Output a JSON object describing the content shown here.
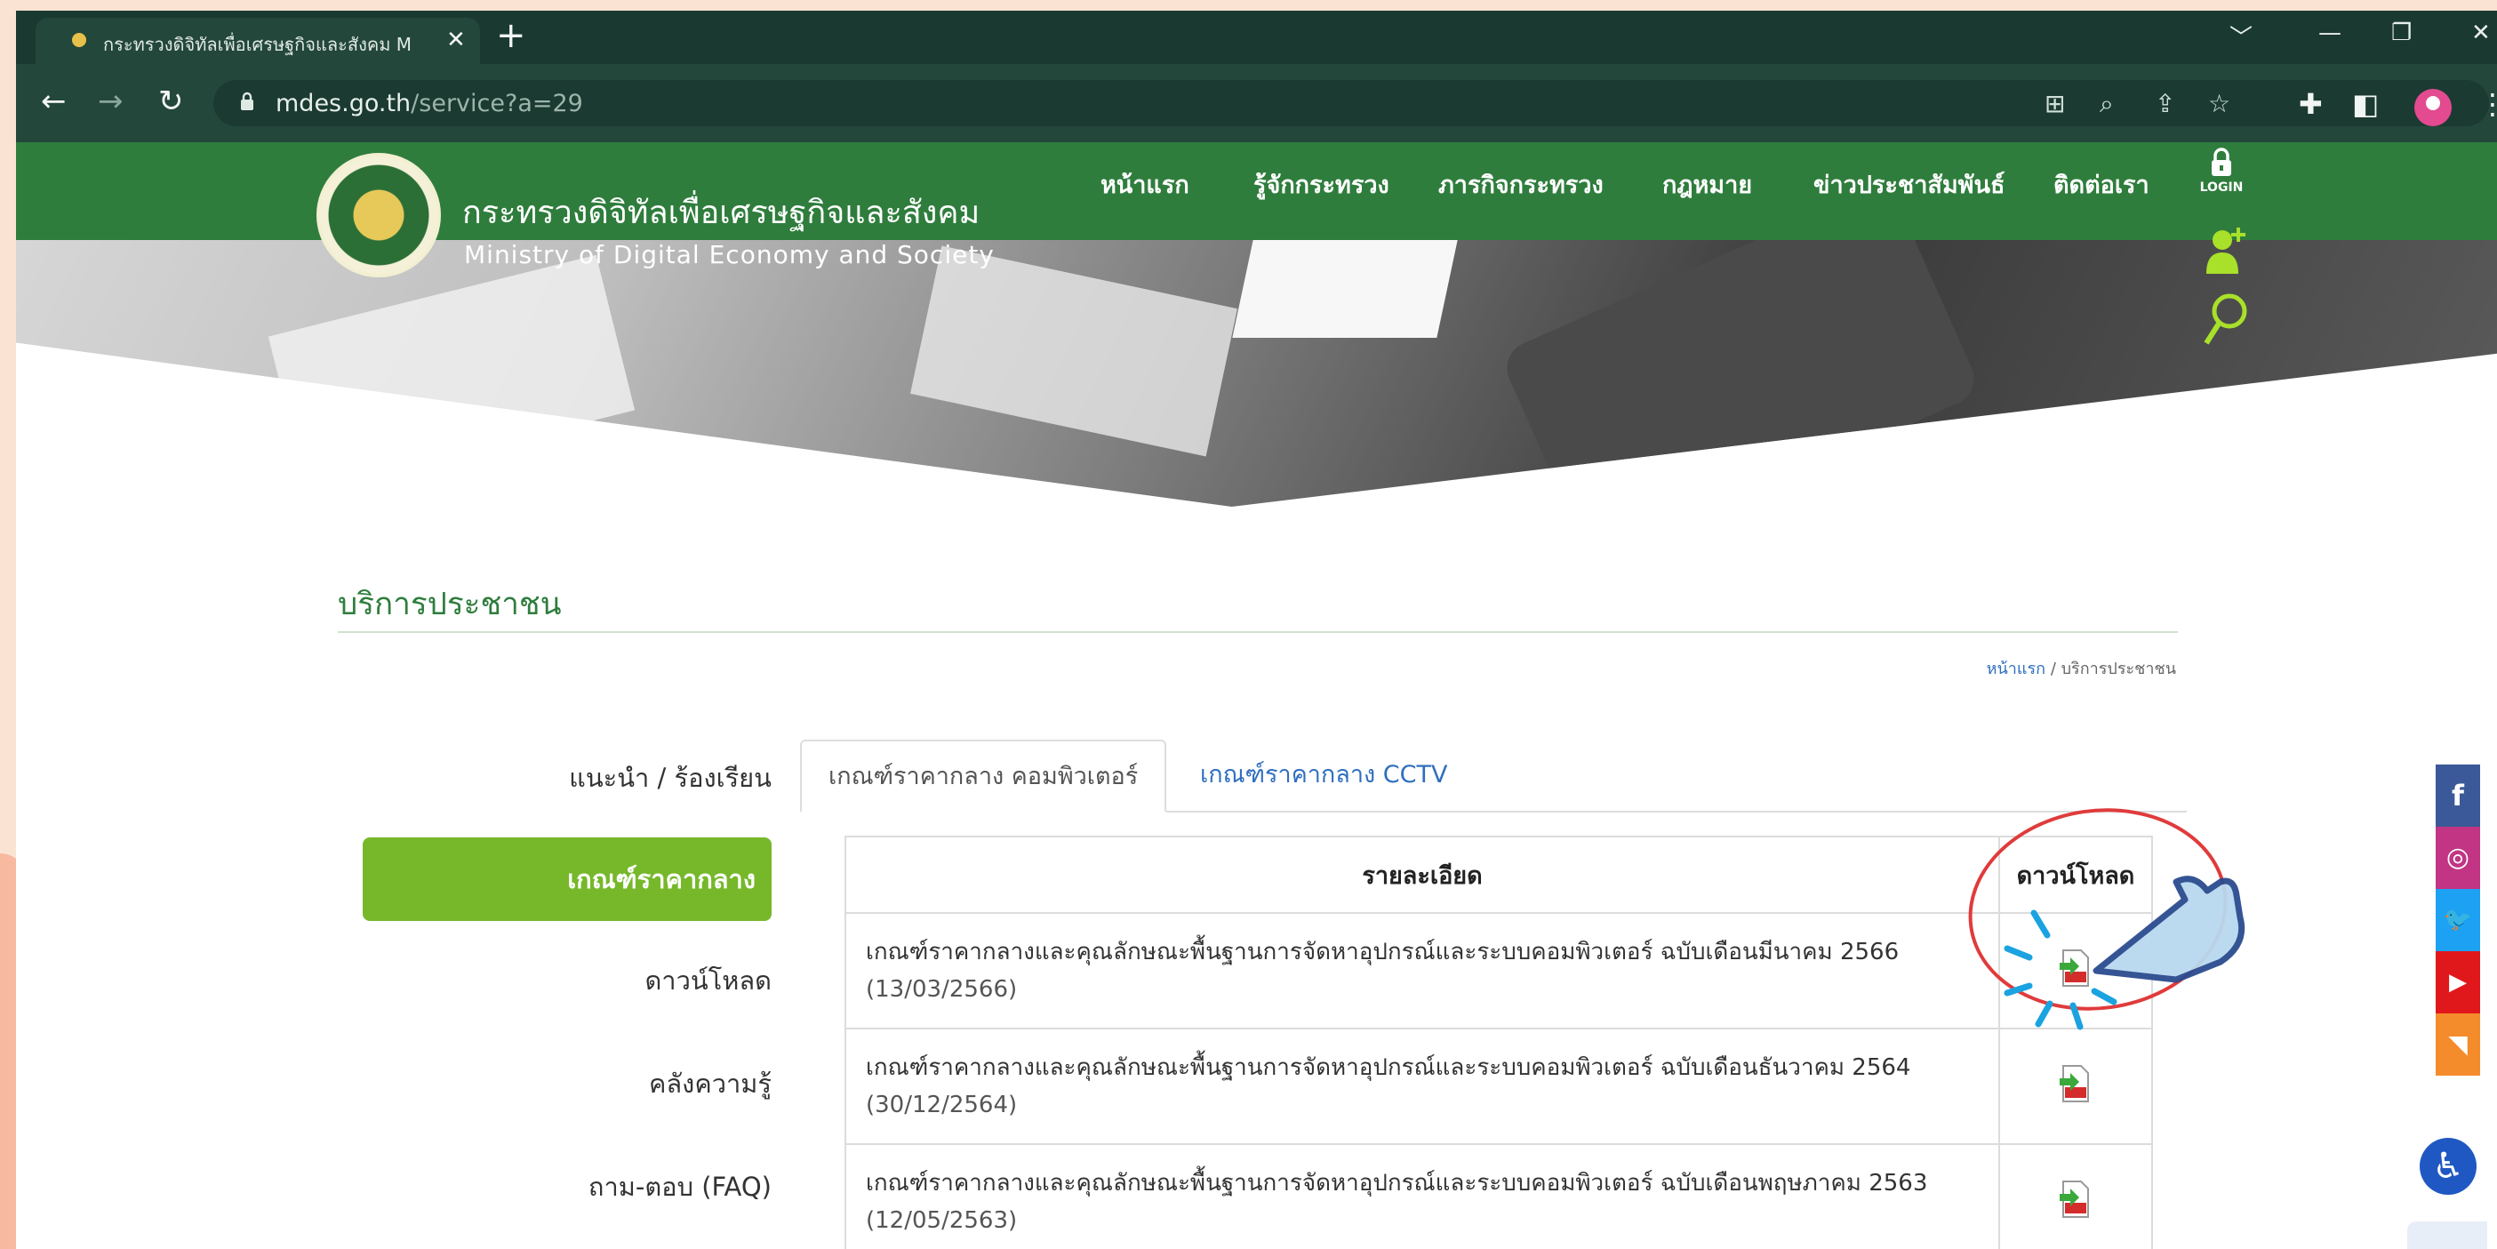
{
  "browser": {
    "tab_title": "กระทรวงดิจิทัลเพื่อเศรษฐกิจและสังคม M",
    "tab_close": "✕",
    "new_tab": "+",
    "url_host": "mdes.go.th",
    "url_path": "/service?a=29",
    "window_controls": [
      "﹀",
      "—",
      "❐",
      "✕"
    ]
  },
  "site": {
    "title_th": "กระทรวงดิจิทัลเพื่อเศรษฐกิจและสังคม",
    "title_en": "Ministry of Digital Economy and Society",
    "nav": [
      "หน้าแรก",
      "รู้จักกระทรวง",
      "ภารกิจกระทรวง",
      "กฎหมาย",
      "ข่าวประชาสัมพันธ์",
      "ติดต่อเรา"
    ],
    "login_label": "LOGIN"
  },
  "page": {
    "section_title": "บริการประชาชน",
    "breadcrumb": {
      "home": "หน้าแรก",
      "separator": "/",
      "current": "บริการประชาชน"
    },
    "sidebar": [
      {
        "label": "แนะนำ / ร้องเรียน",
        "active": false
      },
      {
        "label": "เกณฑ์ราคากลาง",
        "active": true
      },
      {
        "label": "ดาวน์โหลด",
        "active": false
      },
      {
        "label": "คลังความรู้",
        "active": false
      },
      {
        "label": "ถาม-ตอบ (FAQ)",
        "active": false
      }
    ],
    "tabs": [
      {
        "label": "เกณฑ์ราคากลาง คอมพิวเตอร์",
        "active": true
      },
      {
        "label": "เกณฑ์ราคากลาง CCTV",
        "active": false
      }
    ],
    "table": {
      "headers": {
        "detail": "รายละเอียด",
        "download": "ดาวน์โหลด"
      },
      "rows": [
        {
          "title": "เกณฑ์ราคากลางและคุณลักษณะพื้นฐานการจัดหาอุปกรณ์และระบบคอมพิวเตอร์ ฉบับเดือนมีนาคม 2566",
          "date": "(13/03/2566)"
        },
        {
          "title": "เกณฑ์ราคากลางและคุณลักษณะพื้นฐานการจัดหาอุปกรณ์และระบบคอมพิวเตอร์ ฉบับเดือนธันวาคม 2564",
          "date": "(30/12/2564)"
        },
        {
          "title": "เกณฑ์ราคากลางและคุณลักษณะพื้นฐานการจัดหาอุปกรณ์และระบบคอมพิวเตอร์ ฉบับเดือนพฤษภาคม 2563",
          "date": "(12/05/2563)"
        }
      ]
    }
  },
  "social": [
    {
      "name": "facebook",
      "glyph": "f",
      "color": "#3b5998"
    },
    {
      "name": "instagram",
      "glyph": "◎",
      "color": "#c13584"
    },
    {
      "name": "twitter",
      "glyph": "🐦",
      "color": "#1da1f2"
    },
    {
      "name": "youtube",
      "glyph": "▶",
      "color": "#e0181b"
    },
    {
      "name": "rss",
      "glyph": "◥",
      "color": "#f48c2b"
    }
  ],
  "accessibility_glyph": "♿"
}
